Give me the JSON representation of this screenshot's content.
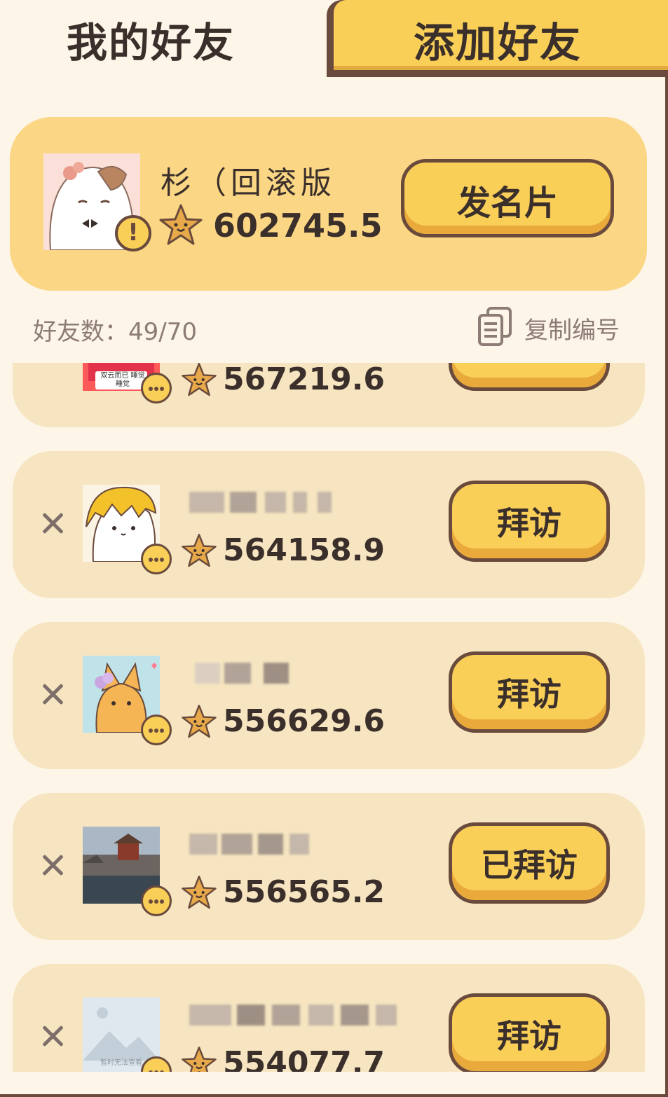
{
  "tabs": {
    "my_friends": "我的好友",
    "add_friend": "添加好友"
  },
  "self": {
    "name": "杉（回滚版",
    "score": "602745.5",
    "card_button": "发名片"
  },
  "friend_count": {
    "label": "好友数：",
    "value": "49/70"
  },
  "copy_id_label": "复制编号",
  "friends": [
    {
      "score": "567219.6",
      "button": "",
      "avatar_text": "双云而已 睡觉睡觉"
    },
    {
      "score": "564158.9",
      "button": "拜访"
    },
    {
      "score": "556629.6",
      "button": "拜访"
    },
    {
      "score": "556565.2",
      "button": "已拜访"
    },
    {
      "score": "554077.7",
      "button": "拜访",
      "avatar_text": "暂时无法查看"
    }
  ],
  "colors": {
    "accent": "#f9cf58",
    "outline": "#6a4a3c",
    "card": "#f6e5c0",
    "self_card": "#fbd785",
    "background": "#fdf5e8"
  }
}
